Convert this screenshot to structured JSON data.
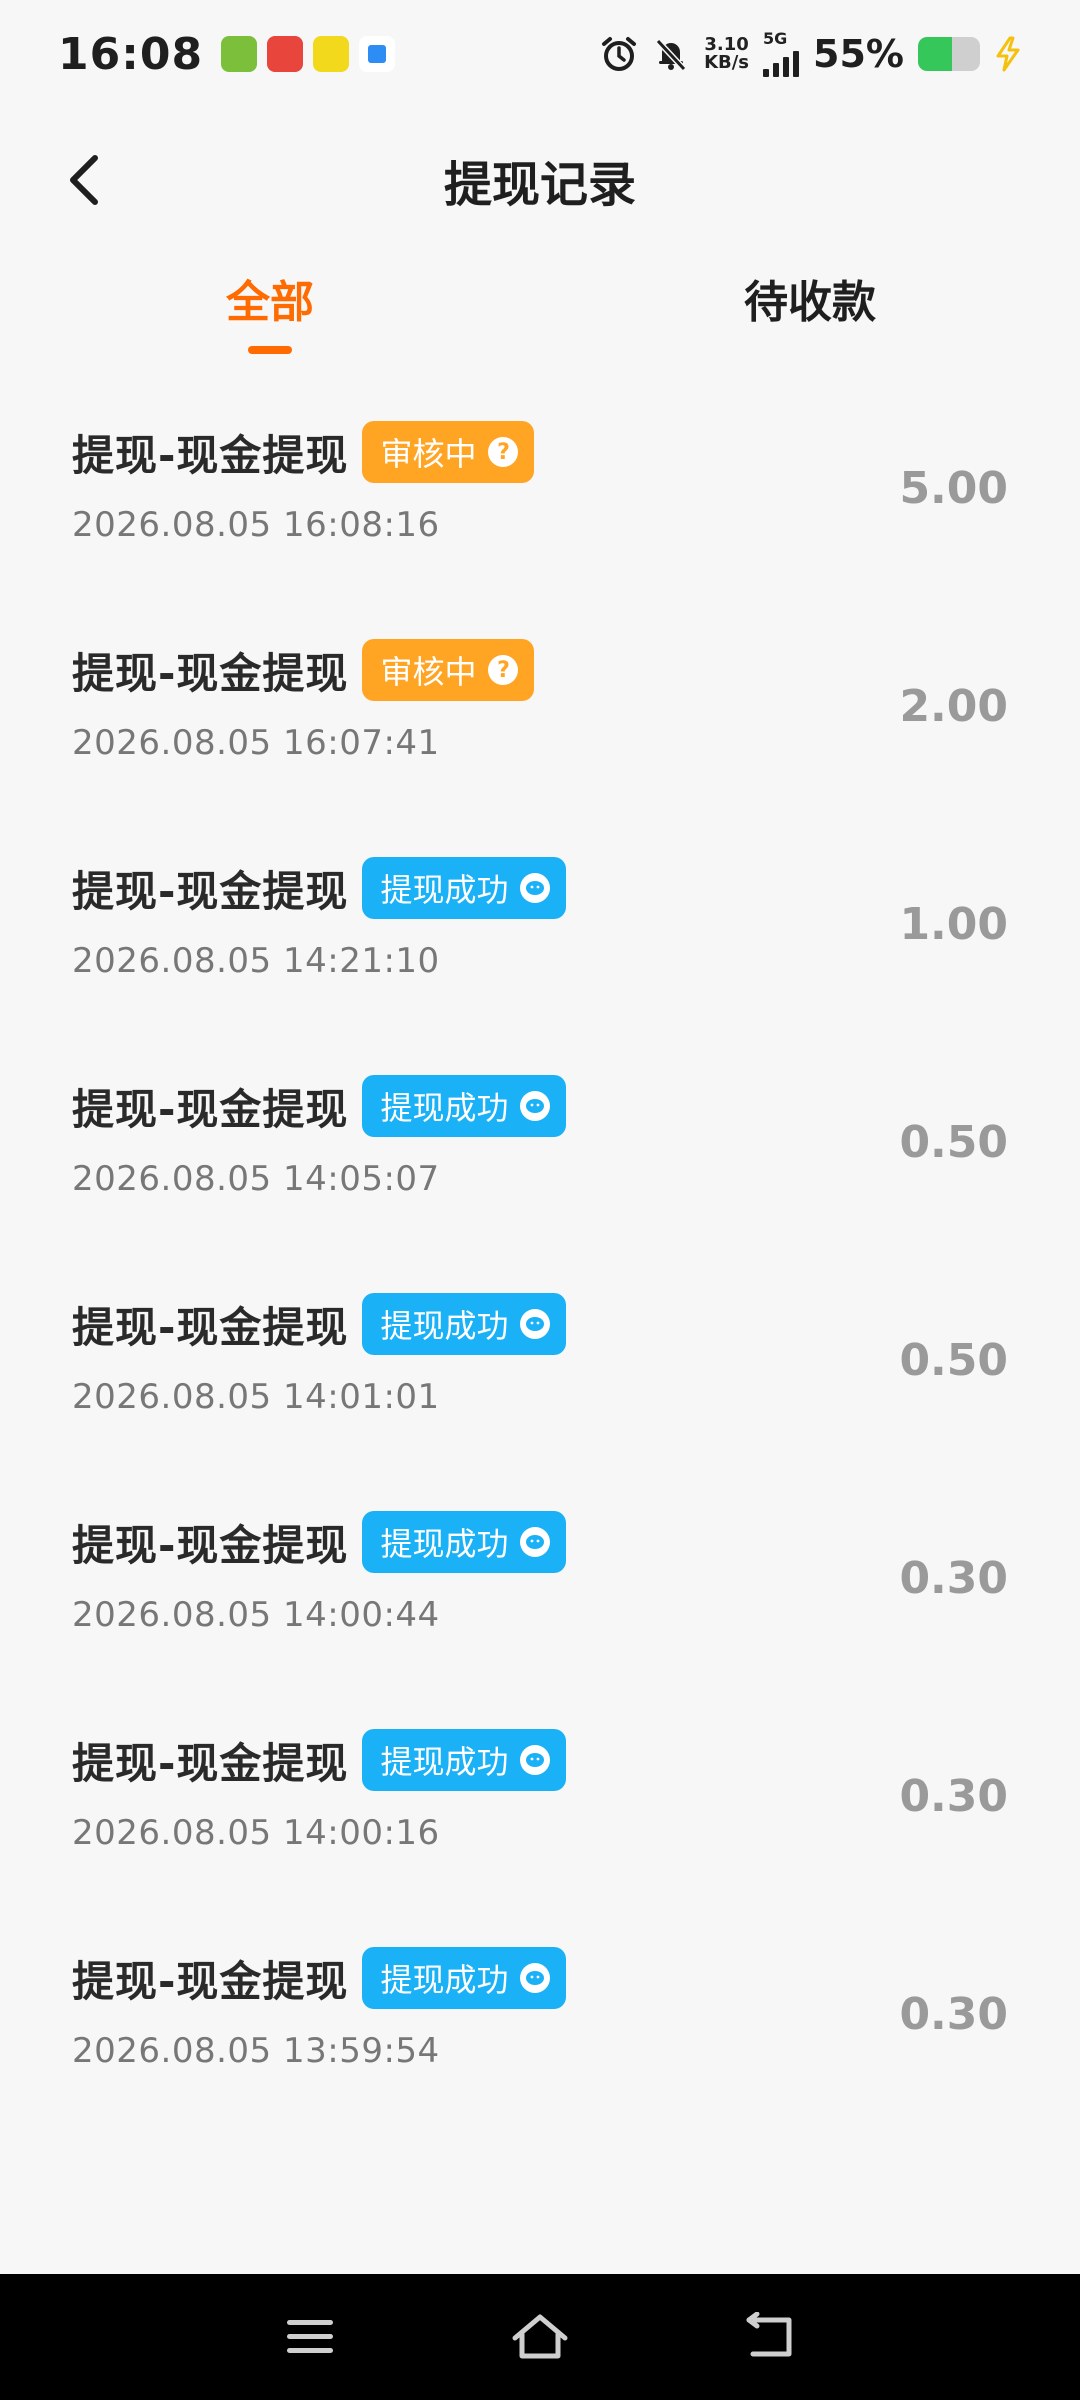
{
  "status_bar": {
    "time": "16:08",
    "net_rate_value": "3.10",
    "net_rate_unit": "KB/s",
    "network": "5G",
    "battery_percent": "55%",
    "battery_level": 0.55,
    "notification_apps": [
      "app-icon-1",
      "app-icon-2",
      "app-icon-3",
      "app-icon-4"
    ],
    "icons": [
      "alarm-icon",
      "mute-icon",
      "signal-icon",
      "battery-icon",
      "charging-icon"
    ]
  },
  "header": {
    "title": "提现记录",
    "back_icon": "chevron-left-icon"
  },
  "tabs": [
    {
      "label": "全部",
      "active": true
    },
    {
      "label": "待收款",
      "active": false
    }
  ],
  "colors": {
    "accent": "#ff6b00",
    "pending": "#ffa423",
    "success": "#1ab1f6",
    "amount": "#9a9a9a"
  },
  "records": [
    {
      "title": "提现-现金提现",
      "status": "审核中",
      "status_type": "pending",
      "time": "2026.08.05 16:08:16",
      "amount": "5.00"
    },
    {
      "title": "提现-现金提现",
      "status": "审核中",
      "status_type": "pending",
      "time": "2026.08.05 16:07:41",
      "amount": "2.00"
    },
    {
      "title": "提现-现金提现",
      "status": "提现成功",
      "status_type": "success",
      "time": "2026.08.05 14:21:10",
      "amount": "1.00"
    },
    {
      "title": "提现-现金提现",
      "status": "提现成功",
      "status_type": "success",
      "time": "2026.08.05 14:05:07",
      "amount": "0.50"
    },
    {
      "title": "提现-现金提现",
      "status": "提现成功",
      "status_type": "success",
      "time": "2026.08.05 14:01:01",
      "amount": "0.50"
    },
    {
      "title": "提现-现金提现",
      "status": "提现成功",
      "status_type": "success",
      "time": "2026.08.05 14:00:44",
      "amount": "0.30"
    },
    {
      "title": "提现-现金提现",
      "status": "提现成功",
      "status_type": "success",
      "time": "2026.08.05 14:00:16",
      "amount": "0.30"
    },
    {
      "title": "提现-现金提现",
      "status": "提现成功",
      "status_type": "success",
      "time": "2026.08.05 13:59:54",
      "amount": "0.30"
    }
  ],
  "system_nav": {
    "icons": [
      "menu-icon",
      "home-icon",
      "back-icon"
    ]
  }
}
